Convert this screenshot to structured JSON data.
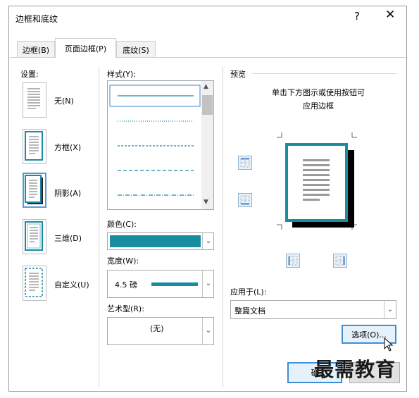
{
  "window": {
    "title": "边框和底纹",
    "help_glyph": "?",
    "close_glyph": "✕"
  },
  "tabs": [
    {
      "label": "边框(B)",
      "active": false
    },
    {
      "label": "页面边框(P)",
      "active": true
    },
    {
      "label": "底纹(S)",
      "active": false
    }
  ],
  "settings": {
    "heading": "设置:",
    "items": [
      {
        "label": "无(N)",
        "selected": false
      },
      {
        "label": "方框(X)",
        "selected": false
      },
      {
        "label": "阴影(A)",
        "selected": true
      },
      {
        "label": "三维(D)",
        "selected": false
      },
      {
        "label": "自定义(U)",
        "selected": false
      }
    ]
  },
  "style": {
    "heading": "样式(Y):",
    "options": [
      "solid",
      "dotted",
      "dashed",
      "long-dashed",
      "dash-dot"
    ],
    "selected": "solid"
  },
  "color": {
    "heading": "颜色(C):",
    "value": "#1a8ca2"
  },
  "width": {
    "heading": "宽度(W):",
    "value": "4.5 磅"
  },
  "art": {
    "heading": "艺术型(R):",
    "value": "(无)"
  },
  "preview": {
    "heading": "预览",
    "hint_line1": "单击下方图示或使用按钮可",
    "hint_line2": "应用边框",
    "border_color": "#1a8ca2",
    "shadow_color": "#000000"
  },
  "apply_to": {
    "heading": "应用于(L):",
    "value": "整篇文档"
  },
  "options_button": "选项(O)...",
  "ok_button": "确",
  "watermark": "最需教育"
}
